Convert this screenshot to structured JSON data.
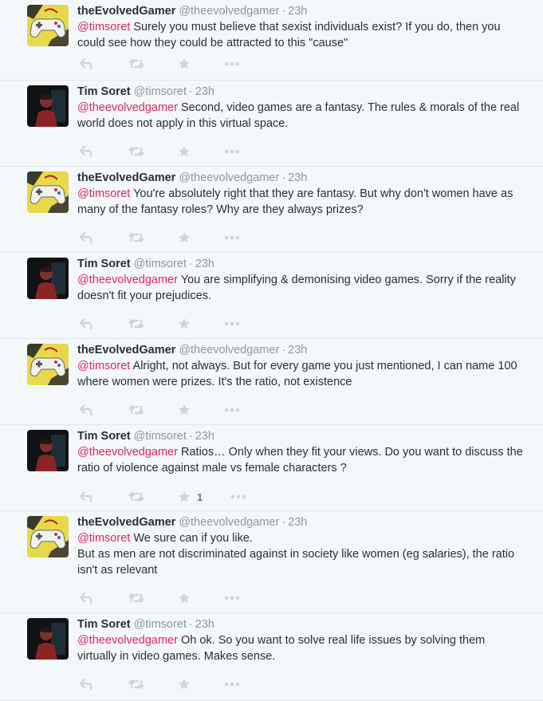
{
  "colors": {
    "mention": "#e0245e",
    "meta": "#8899a6",
    "icon": "#ccd6dd",
    "background": "#f5f8fa"
  },
  "users": {
    "evolved": {
      "name": "theEvolvedGamer",
      "handle": "@theevolvedgamer",
      "avatar": "game-controller-avatar"
    },
    "tim": {
      "name": "Tim Soret",
      "handle": "@timsoret",
      "avatar": "dark-portrait-avatar"
    }
  },
  "tweets": [
    {
      "user": "evolved",
      "time": "23h",
      "mention": "@timsoret",
      "text": "Surely you must believe that sexist individuals exist? If you do, then you could see how they could be attracted to this \"cause\"",
      "text2": "",
      "likes": ""
    },
    {
      "user": "tim",
      "time": "23h",
      "mention": "@theevolvedgamer",
      "text": "Second, video games are a fantasy. The rules & morals of the real world does not apply in this virtual space.",
      "text2": "",
      "likes": ""
    },
    {
      "user": "evolved",
      "time": "23h",
      "mention": "@timsoret",
      "text": "You're absolutely right that they are fantasy. But why don't women have as many of the fantasy roles? Why are they always prizes?",
      "text2": "",
      "likes": ""
    },
    {
      "user": "tim",
      "time": "23h",
      "mention": "@theevolvedgamer",
      "text": "You are simplifying & demonising video games. Sorry if the reality doesn't fit your prejudices.",
      "text2": "",
      "likes": ""
    },
    {
      "user": "evolved",
      "time": "23h",
      "mention": "@timsoret",
      "text": "Alright, not always. But for every game you just mentioned, I can name 100 where women were prizes. It's the ratio, not existence",
      "text2": "",
      "likes": ""
    },
    {
      "user": "tim",
      "time": "23h",
      "mention": "@theevolvedgamer",
      "text": "Ratios… Only when they fit your views. Do you want to discuss the ratio of violence against male vs female characters ?",
      "text2": "",
      "likes": "1"
    },
    {
      "user": "evolved",
      "time": "23h",
      "mention": "@timsoret",
      "text": "We sure can if you like.",
      "text2": "But as men are not discriminated against in society like women (eg salaries), the ratio isn't as relevant",
      "likes": ""
    },
    {
      "user": "tim",
      "time": "23h",
      "mention": "@theevolvedgamer",
      "text": "Oh ok. So you want to solve real life issues by solving them virtually in video games. Makes sense.",
      "text2": "",
      "likes": ""
    }
  ]
}
